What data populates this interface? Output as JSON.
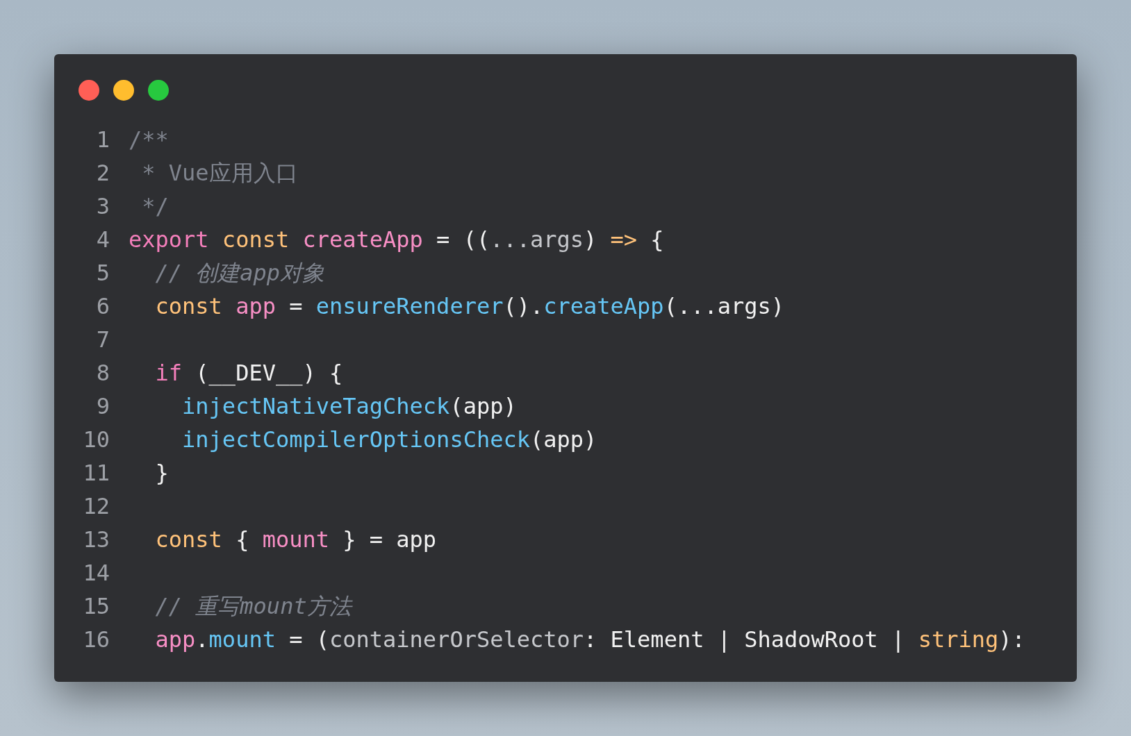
{
  "window": {
    "controls": [
      {
        "color": "#ff5f56"
      },
      {
        "color": "#ffbd2e"
      },
      {
        "color": "#27c93f"
      }
    ]
  },
  "code_lines": [
    {
      "number": "1",
      "tokens": [
        {
          "kind": "comment",
          "text": "/**"
        }
      ]
    },
    {
      "number": "2",
      "tokens": [
        {
          "kind": "comment",
          "text": " * Vue应用入口"
        }
      ]
    },
    {
      "number": "3",
      "tokens": [
        {
          "kind": "comment",
          "text": " */"
        }
      ]
    },
    {
      "number": "4",
      "tokens": [
        {
          "kind": "keyword",
          "text": "export"
        },
        {
          "kind": "storage",
          "text": " const"
        },
        {
          "kind": "variable",
          "text": " createApp"
        },
        {
          "kind": "plain",
          "text": " = (("
        },
        {
          "kind": "param",
          "text": "...args"
        },
        {
          "kind": "plain",
          "text": ") "
        },
        {
          "kind": "storage",
          "text": "=>"
        },
        {
          "kind": "plain",
          "text": " {"
        }
      ]
    },
    {
      "number": "5",
      "tokens": [
        {
          "kind": "line_comment",
          "text": "  // 创建app对象"
        }
      ]
    },
    {
      "number": "6",
      "tokens": [
        {
          "kind": "storage",
          "text": "  const"
        },
        {
          "kind": "variable",
          "text": " app"
        },
        {
          "kind": "plain",
          "text": " = "
        },
        {
          "kind": "function",
          "text": "ensureRenderer"
        },
        {
          "kind": "plain",
          "text": "()."
        },
        {
          "kind": "function",
          "text": "createApp"
        },
        {
          "kind": "plain",
          "text": "(...args)"
        }
      ]
    },
    {
      "number": "7"
    },
    {
      "number": "8",
      "tokens": [
        {
          "kind": "keyword",
          "text": "  if"
        },
        {
          "kind": "plain",
          "text": " (__DEV__) {"
        }
      ]
    },
    {
      "number": "9",
      "tokens": [
        {
          "kind": "function",
          "text": "    injectNativeTagCheck"
        },
        {
          "kind": "plain",
          "text": "(app)"
        }
      ]
    },
    {
      "number": "10",
      "tokens": [
        {
          "kind": "function",
          "text": "    injectCompilerOptionsCheck"
        },
        {
          "kind": "plain",
          "text": "(app)"
        }
      ]
    },
    {
      "number": "11",
      "tokens": [
        {
          "kind": "plain",
          "text": "  }"
        }
      ]
    },
    {
      "number": "12"
    },
    {
      "number": "13",
      "tokens": [
        {
          "kind": "storage",
          "text": "  const"
        },
        {
          "kind": "plain",
          "text": " { "
        },
        {
          "kind": "variable",
          "text": "mount"
        },
        {
          "kind": "plain",
          "text": " } = app"
        }
      ]
    },
    {
      "number": "14"
    },
    {
      "number": "15",
      "tokens": [
        {
          "kind": "line_comment",
          "text": "  // 重写mount方法"
        }
      ]
    },
    {
      "number": "16",
      "tokens": [
        {
          "kind": "variable",
          "text": "  app"
        },
        {
          "kind": "plain",
          "text": "."
        },
        {
          "kind": "function",
          "text": "mount"
        },
        {
          "kind": "plain",
          "text": " = ("
        },
        {
          "kind": "param",
          "text": "containerOrSelector"
        },
        {
          "kind": "plain",
          "text": ": Element | ShadowRoot | "
        },
        {
          "kind": "storage",
          "text": "string"
        },
        {
          "kind": "plain",
          "text": "):"
        }
      ]
    }
  ]
}
